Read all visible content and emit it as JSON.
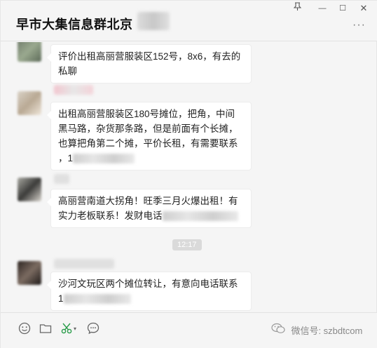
{
  "window": {
    "title": "早市大集信息群北京",
    "pin_icon": "pin-icon",
    "minimize_glyph": "—",
    "maximize_glyph": "☐",
    "close_glyph": "✕",
    "more_glyph": "···"
  },
  "messages": [
    {
      "lines": [
        "评价出租高丽营服装区152号，8x6，有去的",
        "私聊"
      ]
    },
    {
      "lines": [
        "出租高丽营服装区180号摊位，把角，中间",
        "黑马路，杂货那条路，但是前面有个长摊，",
        "也算把角第二个摊，平价长租，有需要联系",
        "，1"
      ]
    },
    {
      "lines": [
        "高丽营南道大拐角！旺季三月火爆出租！有",
        "实力老板联系！发财电话"
      ]
    },
    {
      "lines": [
        "沙河文玩区两个摊位转让，有意向电话联系",
        "1"
      ]
    }
  ],
  "timestamp": "12:17",
  "toolbar": {
    "emoji_icon": "emoji-icon",
    "folder_icon": "folder-icon",
    "scissors_icon": "scissors-icon",
    "chat_icon": "chat-bubble-icon"
  },
  "watermark": {
    "text": "微信号: szbdtcom"
  }
}
